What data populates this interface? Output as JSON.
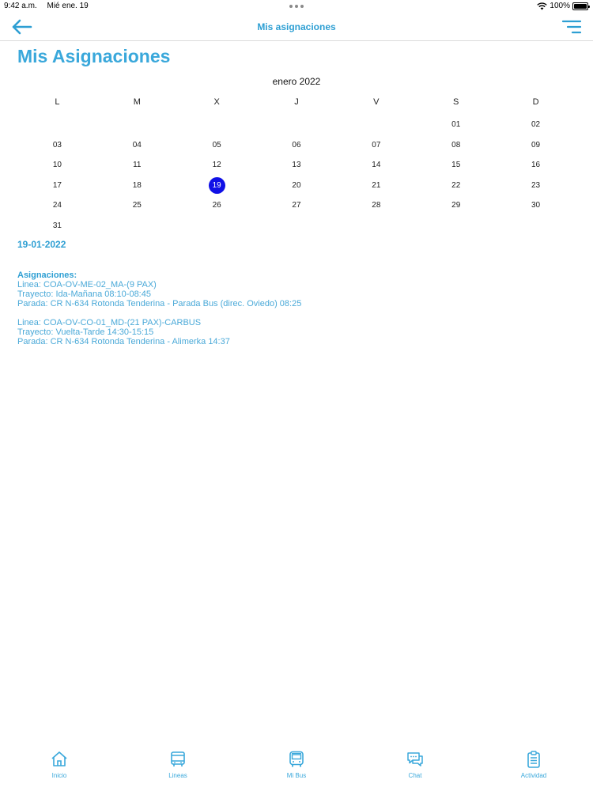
{
  "status_bar": {
    "time": "9:42 a.m.",
    "date": "Mié ene. 19",
    "battery": "100%"
  },
  "nav": {
    "title": "Mis asignaciones"
  },
  "page": {
    "title": "Mis Asignaciones"
  },
  "calendar": {
    "month": "enero 2022",
    "weekdays": [
      "L",
      "M",
      "X",
      "J",
      "V",
      "S",
      "D"
    ],
    "leading_blanks": 5,
    "days": [
      "01",
      "02",
      "03",
      "04",
      "05",
      "06",
      "07",
      "08",
      "09",
      "10",
      "11",
      "12",
      "13",
      "14",
      "15",
      "16",
      "17",
      "18",
      "19",
      "20",
      "21",
      "22",
      "23",
      "24",
      "25",
      "26",
      "27",
      "28",
      "29",
      "30",
      "31"
    ],
    "selected": "19"
  },
  "selected_date": "19-01-2022",
  "assignments": {
    "heading": "Asignaciones:",
    "items": [
      {
        "linea": "Linea: COA-OV-ME-02_MA-(9 PAX)",
        "trayecto": "Trayecto: Ida-Mañana 08:10-08:45",
        "parada": "Parada: CR N-634 Rotonda Tenderina - Parada Bus (direc. Oviedo) 08:25"
      },
      {
        "linea": "Linea: COA-OV-CO-01_MD-(21 PAX)-CARBUS",
        "trayecto": "Trayecto: Vuelta-Tarde 14:30-15:15",
        "parada": "Parada: CR N-634 Rotonda Tenderina - Alimerka 14:37"
      }
    ]
  },
  "tabs": [
    {
      "label": "Inicio",
      "icon": "home-icon"
    },
    {
      "label": "Lineas",
      "icon": "bus-stop-icon"
    },
    {
      "label": "Mi Bus",
      "icon": "bus-icon"
    },
    {
      "label": "Chat",
      "icon": "chat-icon"
    },
    {
      "label": "Actividad",
      "icon": "clipboard-icon"
    }
  ],
  "colors": {
    "accent": "#3aa8db",
    "selected_day": "#1010e6"
  }
}
